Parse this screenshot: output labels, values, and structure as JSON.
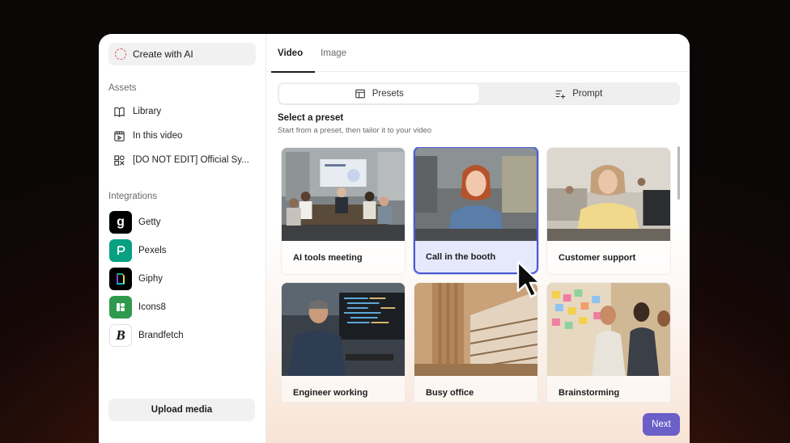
{
  "sidebar": {
    "create_label": "Create with AI",
    "assets_title": "Assets",
    "assets": [
      {
        "label": "Library",
        "icon": "book-icon"
      },
      {
        "label": "In this video",
        "icon": "video-frame-icon"
      },
      {
        "label": "[DO NOT EDIT] Official Sy...",
        "icon": "brand-kit-icon"
      }
    ],
    "integrations_title": "Integrations",
    "integrations": [
      {
        "label": "Getty",
        "icon": "getty-logo",
        "color": "#000000"
      },
      {
        "label": "Pexels",
        "icon": "pexels-logo",
        "color": "#07a081"
      },
      {
        "label": "Giphy",
        "icon": "giphy-logo",
        "color": "#000000"
      },
      {
        "label": "Icons8",
        "icon": "icons8-logo",
        "color": "#2e9a4d"
      },
      {
        "label": "Brandfetch",
        "icon": "brandfetch-logo",
        "color": "#ffffff"
      }
    ],
    "upload_label": "Upload media"
  },
  "tabs": [
    {
      "label": "Video",
      "active": true
    },
    {
      "label": "Image",
      "active": false
    }
  ],
  "segmented": {
    "presets_label": "Presets",
    "prompt_label": "Prompt",
    "active": "Presets"
  },
  "presets": {
    "title": "Select a preset",
    "subtitle": "Start from a preset, then tailor it to your video",
    "items": [
      {
        "label": "AI tools meeting",
        "selected": false
      },
      {
        "label": "Call in the booth",
        "selected": true
      },
      {
        "label": "Customer support",
        "selected": false
      },
      {
        "label": "Engineer working",
        "selected": false
      },
      {
        "label": "Busy office",
        "selected": false
      },
      {
        "label": "Brainstorming",
        "selected": false
      }
    ]
  },
  "footer": {
    "next_label": "Next"
  },
  "colors": {
    "accent": "#6b5fc8",
    "selected_border": "#4a5bd1",
    "selected_bg": "#e6e8fb"
  }
}
